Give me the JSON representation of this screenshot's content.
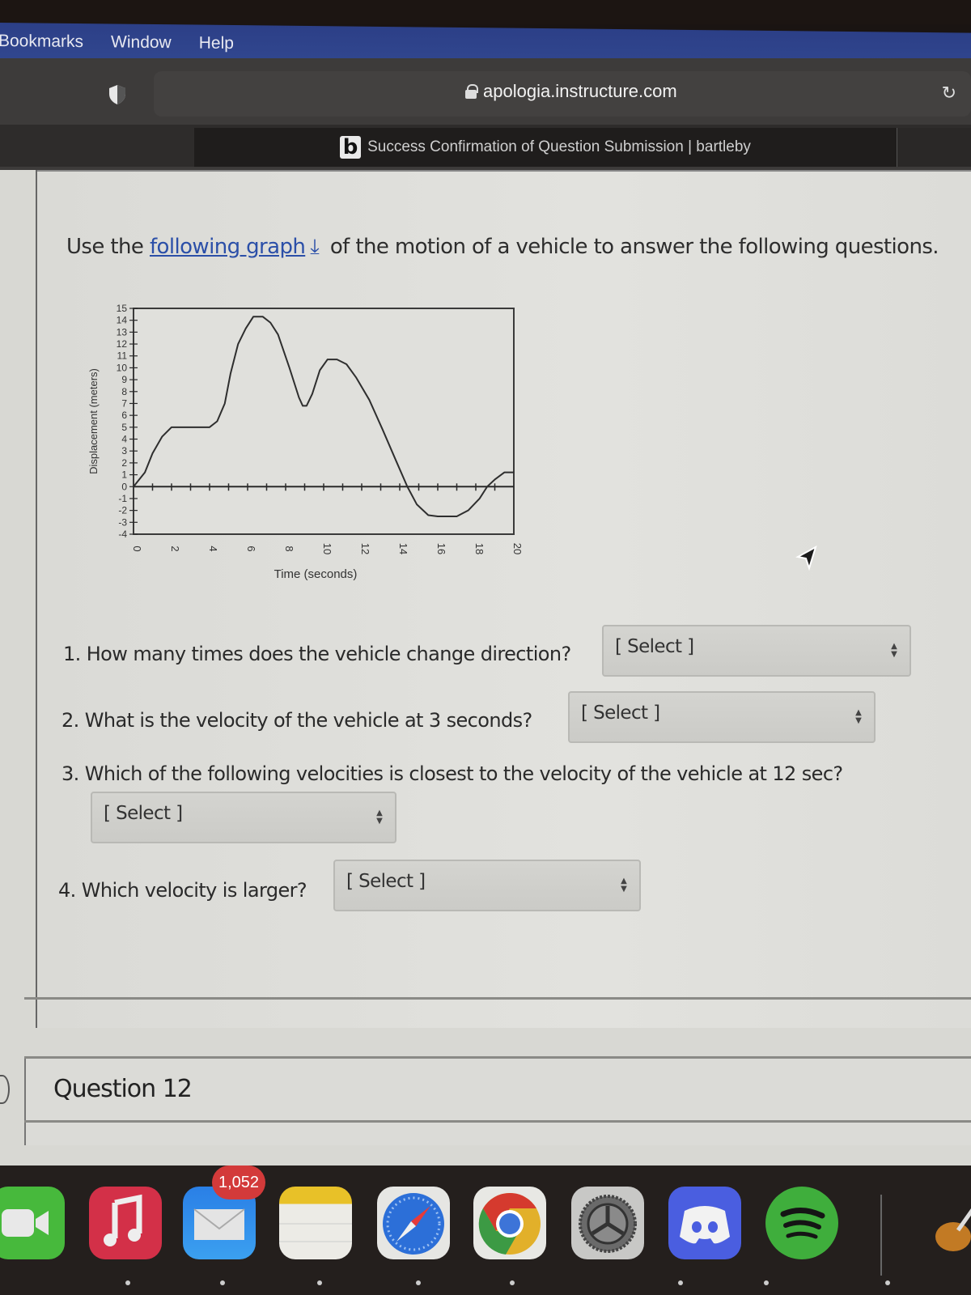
{
  "menubar": {
    "items": [
      "Bookmarks",
      "Window",
      "Help"
    ]
  },
  "browser": {
    "url": "apologia.instructure.com",
    "active_tab_title": "Success Confirmation of Question Submission | bartleby",
    "tab_favicon_letter": "b"
  },
  "content": {
    "intro_prefix": "Use the ",
    "intro_link": "following graph",
    "intro_suffix": " of the motion of a vehicle to answer the following questions.",
    "questions": [
      {
        "text": "1. How many times does the vehicle change direction?",
        "select_value": "[ Select ]"
      },
      {
        "text": "2. What is the velocity of the vehicle at 3 seconds?",
        "select_value": "[ Select ]"
      },
      {
        "text": "3. Which of the following velocities is closest to the velocity of the vehicle at 12 sec?",
        "select_value": "[ Select ]"
      },
      {
        "text": "4. Which velocity is larger?",
        "select_value": "[ Select ]"
      }
    ],
    "next_question_title": "Question 12"
  },
  "dock": {
    "apps": [
      "FaceTime",
      "Music",
      "Mail",
      "Notes",
      "Safari",
      "Chrome",
      "System Preferences",
      "Discord",
      "Spotify",
      "GarageBand"
    ],
    "mail_badge": "1,052"
  },
  "chart_data": {
    "type": "line",
    "title": "",
    "xlabel": "Time (seconds)",
    "ylabel": "Displacement (meters)",
    "xlim": [
      0,
      20
    ],
    "ylim": [
      -4,
      15
    ],
    "xticks": [
      0,
      2,
      4,
      6,
      8,
      10,
      12,
      14,
      16,
      18,
      20
    ],
    "yticks": [
      15,
      14,
      13,
      12,
      11,
      10,
      9,
      8,
      7,
      6,
      5,
      4,
      3,
      2,
      1,
      0,
      -1,
      -2,
      -3,
      -4
    ],
    "grid": false,
    "series": [
      {
        "name": "displacement",
        "x": [
          0,
          0.6,
          1.0,
          1.5,
          2.0,
          2.2,
          4.0,
          4.4,
          4.8,
          5.1,
          5.5,
          5.9,
          6.3,
          6.8,
          7.2,
          7.6,
          8.2,
          8.7,
          8.9,
          9.1,
          9.4,
          9.8,
          10.2,
          10.7,
          11.2,
          11.7,
          12.4,
          13.1,
          13.8,
          14.4,
          14.9,
          15.5,
          16.0,
          17.0,
          17.6,
          18.2,
          18.6,
          19.0,
          19.5,
          20.0
        ],
        "y": [
          0,
          1.2,
          2.8,
          4.2,
          5.0,
          5.0,
          5.0,
          5.5,
          7.0,
          9.5,
          12.0,
          13.3,
          14.3,
          14.3,
          13.8,
          12.8,
          10.0,
          7.5,
          6.8,
          6.8,
          7.8,
          9.8,
          10.7,
          10.7,
          10.3,
          9.2,
          7.3,
          4.8,
          2.2,
          0.0,
          -1.5,
          -2.4,
          -2.5,
          -2.5,
          -2.0,
          -1.0,
          0.0,
          0.6,
          1.2,
          1.2
        ]
      }
    ]
  }
}
